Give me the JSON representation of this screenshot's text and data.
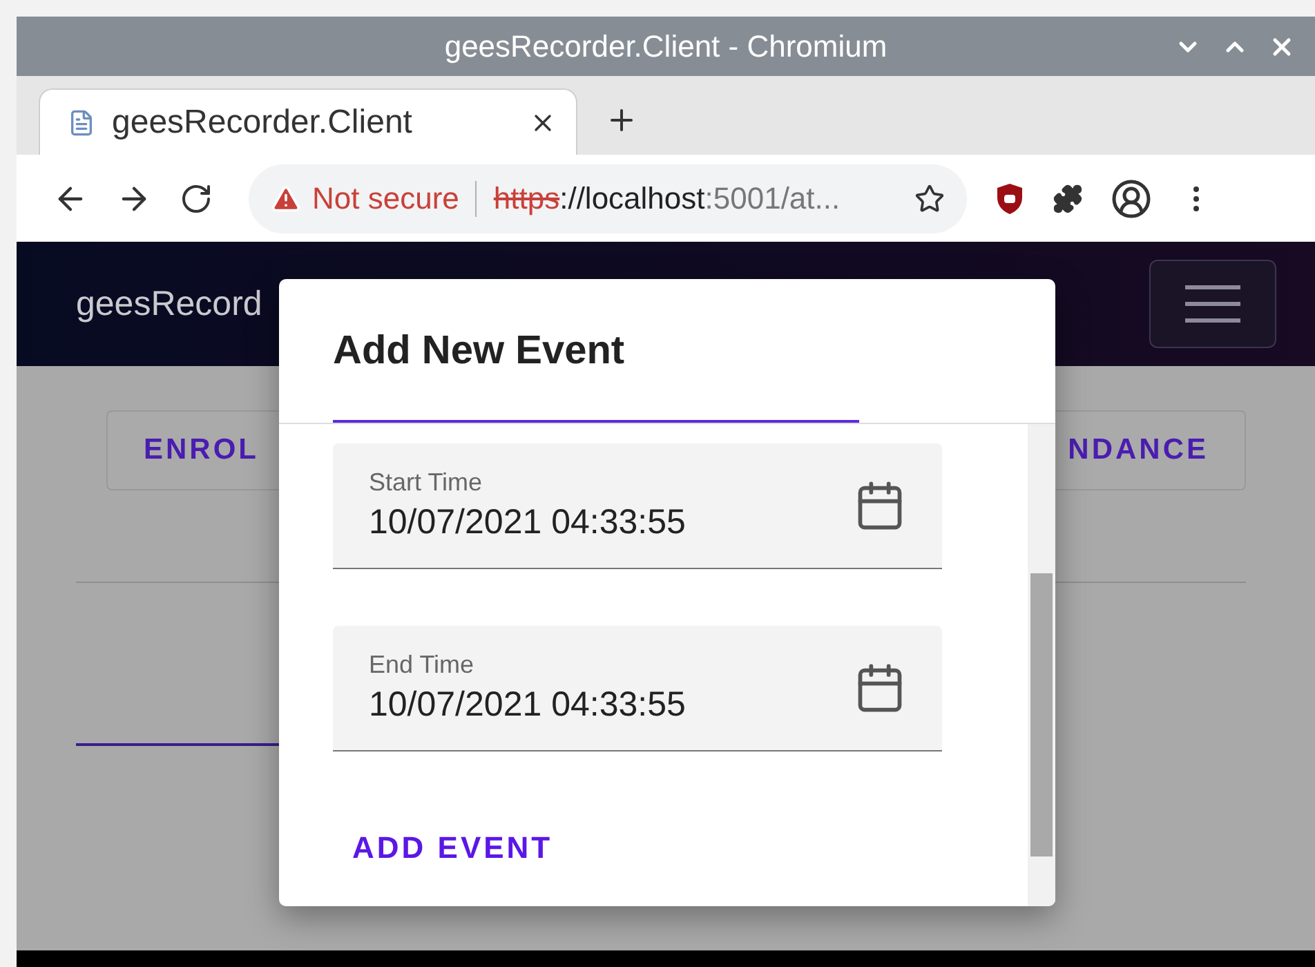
{
  "window": {
    "title": "geesRecorder.Client - Chromium"
  },
  "tabs": [
    {
      "title": "geesRecorder.Client",
      "selected": true
    }
  ],
  "address_bar": {
    "security": "Not secure",
    "scheme": "https",
    "host": "://localhost",
    "path": ":5001/at..."
  },
  "app": {
    "brand": "geesRecord",
    "buttons": [
      "ENROL",
      "NDANCE"
    ]
  },
  "dialog": {
    "title": "Add New Event",
    "fields": [
      {
        "label": "Start Time",
        "value": "10/07/2021 04:33:55"
      },
      {
        "label": "End Time",
        "value": "10/07/2021 04:33:55"
      }
    ],
    "action": "ADD EVENT"
  }
}
